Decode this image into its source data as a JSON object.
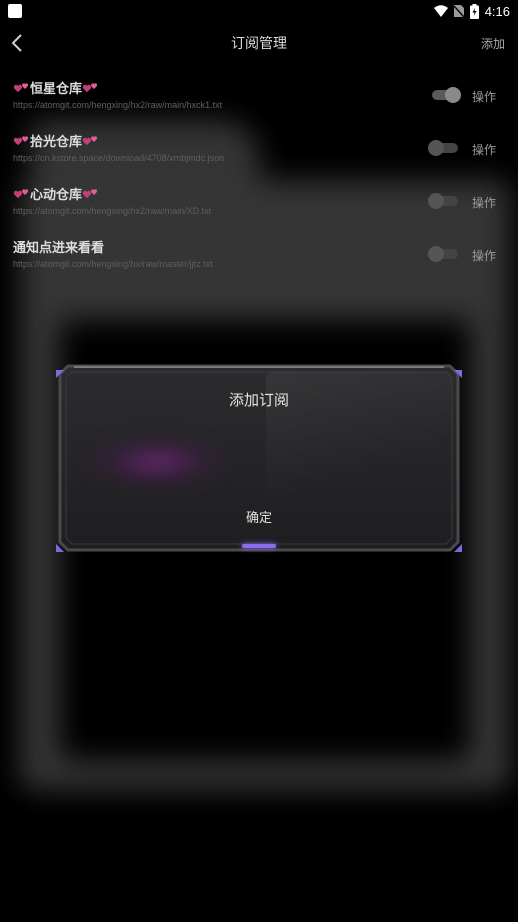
{
  "status_bar": {
    "time": "4:16",
    "icons": [
      "square-icon",
      "wifi-icon",
      "no-sim-icon",
      "battery-charging-icon"
    ]
  },
  "app_bar": {
    "title": "订阅管理",
    "add_label": "添加"
  },
  "subscriptions": [
    {
      "name": "恒星仓库",
      "decorated": true,
      "url": "https://atomgit.com/hengxing/hx2/raw/main/hxck1.txt",
      "enabled": true,
      "action_label": "操作"
    },
    {
      "name": "拾光仓库",
      "decorated": true,
      "url": "https://cn.kstore.space/download/4708/xmbjmdc.json",
      "enabled": false,
      "action_label": "操作"
    },
    {
      "name": "心动仓库",
      "decorated": true,
      "url": "https://atomgit.com/hengxing/hx2/raw/main/XD.txt",
      "enabled": false,
      "action_label": "操作"
    },
    {
      "name": "通知点进来看看",
      "decorated": false,
      "url": "https://atomgit.com/hengxing/hx/raw/master/jjtz.txt",
      "enabled": false,
      "action_label": "操作"
    }
  ],
  "dialog": {
    "title": "添加订阅",
    "confirm_label": "确定"
  },
  "colors": {
    "background": "#000000",
    "accent": "#8a6cf0",
    "heart": "#c2407a"
  }
}
